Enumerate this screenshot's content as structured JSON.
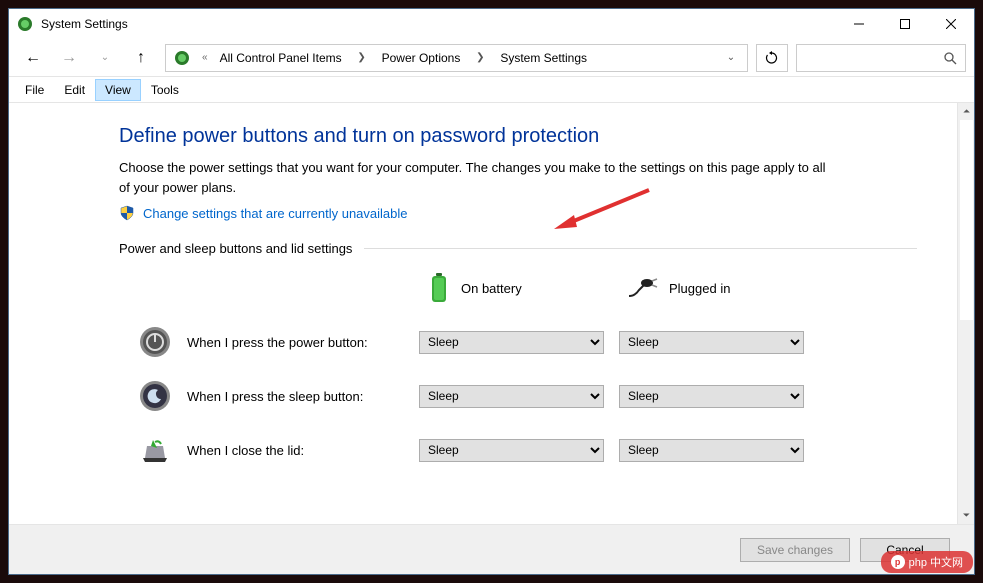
{
  "titlebar": {
    "title": "System Settings"
  },
  "breadcrumb": {
    "prefix": "«",
    "items": [
      "All Control Panel Items",
      "Power Options",
      "System Settings"
    ]
  },
  "menubar": {
    "items": [
      "File",
      "Edit",
      "View",
      "Tools"
    ],
    "selected": 2
  },
  "page": {
    "heading": "Define power buttons and turn on password protection",
    "description": "Choose the power settings that you want for your computer. The changes you make to the settings on this page apply to all of your power plans.",
    "change_link": "Change settings that are currently unavailable",
    "section": "Power and sleep buttons and lid settings",
    "columns": {
      "battery": "On battery",
      "plugged": "Plugged in"
    },
    "rows": [
      {
        "label": "When I press the power button:",
        "battery": "Sleep",
        "plugged": "Sleep"
      },
      {
        "label": "When I press the sleep button:",
        "battery": "Sleep",
        "plugged": "Sleep"
      },
      {
        "label": "When I close the lid:",
        "battery": "Sleep",
        "plugged": "Sleep"
      }
    ]
  },
  "footer": {
    "save": "Save changes",
    "cancel": "Cancel"
  },
  "watermark": "php 中文网"
}
